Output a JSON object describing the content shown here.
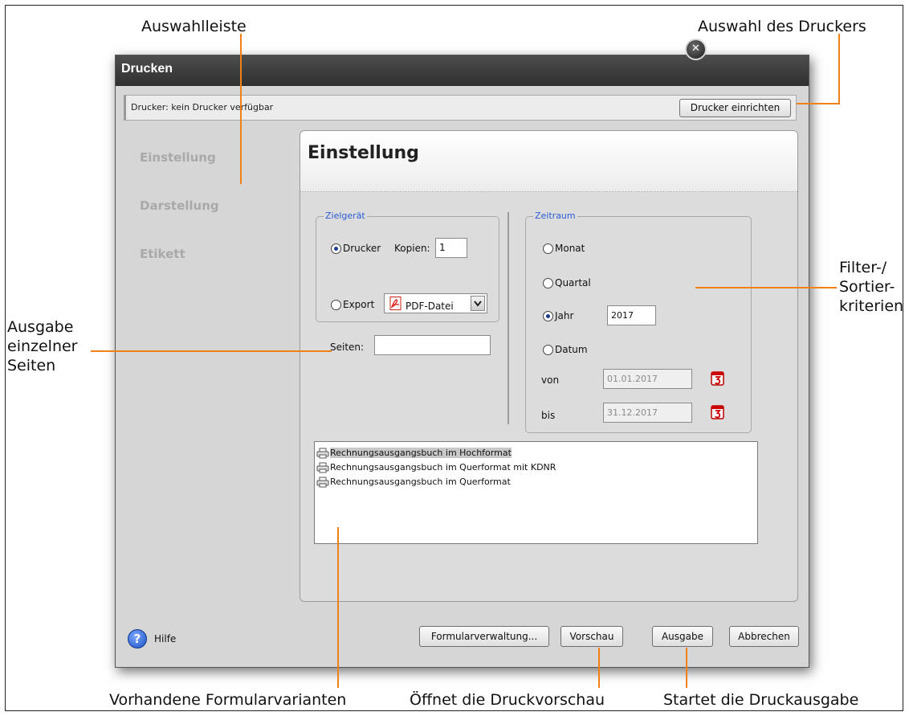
{
  "callouts": {
    "auswahlleiste": "Auswahlleiste",
    "auswahl_drucker": "Auswahl des Druckers",
    "filter_1": "Filter-/",
    "filter_2": "Sortier-",
    "filter_3": "kriterien",
    "ausgabe_1": "Ausgabe",
    "ausgabe_2": "einzelner",
    "ausgabe_3": "Seiten",
    "formularvarianten": "Vorhandene Formularvarianten",
    "druckvorschau": "Öffnet die Druckvorschau",
    "druckausgabe": "Startet die Druckausgabe"
  },
  "dialog": {
    "title": "Drucken",
    "close_icon": "close-icon",
    "printer_label": "Drucker: kein Drucker verfügbar",
    "printer_button": "Drucker einrichten"
  },
  "nav": {
    "items": [
      "Einstellung",
      "Darstellung",
      "Etikett"
    ]
  },
  "panel": {
    "title": "Einstellung",
    "zielgeraet": {
      "legend": "Zielgerät",
      "drucker_label": "Drucker",
      "drucker_selected": true,
      "kopien_label": "Kopien:",
      "kopien_value": "1",
      "export_label": "Export",
      "export_selected": false,
      "export_format": "PDF-Datei"
    },
    "seiten_label": "Seiten:",
    "seiten_value": "",
    "zeitraum": {
      "legend": "Zeitraum",
      "options": [
        "Monat",
        "Quartal",
        "Jahr",
        "Datum"
      ],
      "selected": "Jahr",
      "jahr_value": "2017",
      "von_label": "von",
      "von_value": "01.01.2017",
      "bis_label": "bis",
      "bis_value": "31.12.2017"
    },
    "forms": [
      "Rechnungsausgangsbuch im Hochformat",
      "Rechnungsausgangsbuch im Querformat mit KDNR",
      "Rechnungsausgangsbuch im Querformat"
    ],
    "selected_form": 0
  },
  "footer": {
    "help_label": "Hilfe",
    "buttons": {
      "formularverwaltung": "Formularverwaltung...",
      "vorschau": "Vorschau",
      "ausgabe": "Ausgabe",
      "abbrechen": "Abbrechen"
    }
  },
  "colors": {
    "callout_line": "#f08018",
    "legend_text": "#2a5bd7",
    "titlebar": "#3a3a3a"
  }
}
